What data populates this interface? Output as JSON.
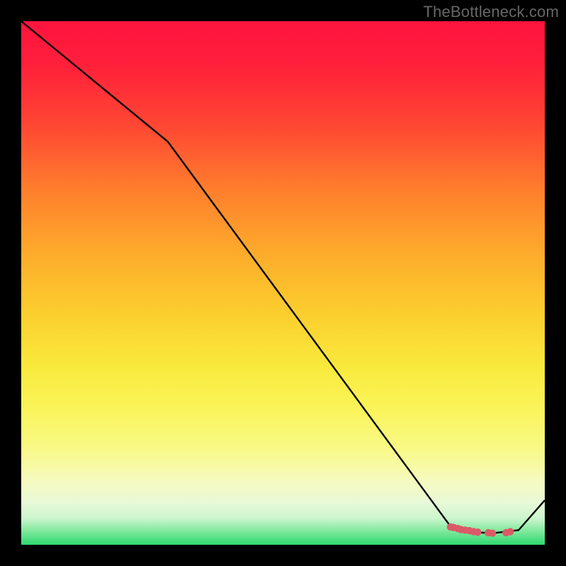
{
  "watermark": "TheBottleneck.com",
  "chart_data": {
    "type": "line",
    "title": "",
    "xlabel": "",
    "ylabel": "",
    "xlim": [
      0,
      100
    ],
    "ylim": [
      0,
      100
    ],
    "series": [
      {
        "name": "curve",
        "x": [
          0,
          28,
          82,
          85,
          90,
          95,
          100
        ],
        "y": [
          100,
          77,
          3.5,
          2.5,
          2.2,
          2.8,
          8.5
        ]
      }
    ],
    "markers": {
      "name": "bottom-cluster",
      "color": "#db5a68",
      "points": [
        {
          "x": 82.0,
          "y": 3.4
        },
        {
          "x": 82.6,
          "y": 3.3
        },
        {
          "x": 83.4,
          "y": 3.1
        },
        {
          "x": 84.0,
          "y": 2.9
        },
        {
          "x": 84.8,
          "y": 2.8
        },
        {
          "x": 85.6,
          "y": 2.7
        },
        {
          "x": 86.4,
          "y": 2.5
        },
        {
          "x": 87.2,
          "y": 2.4
        },
        {
          "x": 89.2,
          "y": 2.3
        },
        {
          "x": 90.0,
          "y": 2.2
        },
        {
          "x": 92.6,
          "y": 2.3
        },
        {
          "x": 93.4,
          "y": 2.5
        }
      ]
    },
    "gradient_stops": [
      {
        "pos": 0.0,
        "color": "#ff143e"
      },
      {
        "pos": 0.5,
        "color": "#fbcf2e"
      },
      {
        "pos": 0.85,
        "color": "#f8f989"
      },
      {
        "pos": 1.0,
        "color": "#2fd871"
      }
    ]
  }
}
